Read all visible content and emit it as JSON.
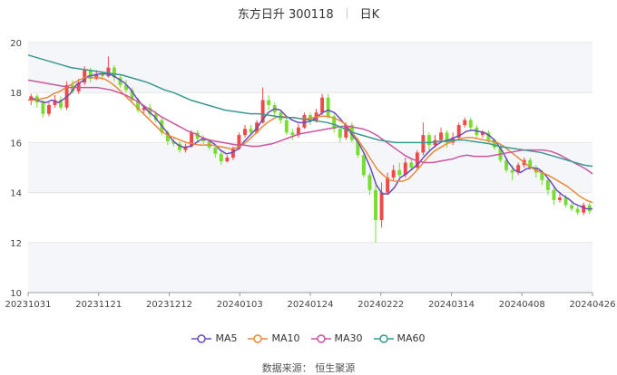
{
  "title": {
    "name": "东方日升",
    "code": "300118",
    "period": "日K"
  },
  "source": "数据来源： 恒生聚源",
  "chart_data": {
    "type": "candlestick",
    "ylim": [
      10,
      20
    ],
    "yticks": [
      "10",
      "12",
      "14",
      "16",
      "18",
      "20"
    ],
    "xticks": [
      "20231031",
      "20231121",
      "20231212",
      "20240103",
      "20240124",
      "20240222",
      "20240314",
      "20240408",
      "20240426"
    ],
    "grid": true,
    "legend_position": "bottom",
    "colors": {
      "up": "#ee4a4a",
      "down": "#77dd33",
      "ma5": "#6a4bbd",
      "ma10": "#e8893b",
      "ma30": "#cc55a0",
      "ma60": "#3a9990"
    },
    "series": [
      {
        "name": "MA5",
        "key": "ma5"
      },
      {
        "name": "MA10",
        "key": "ma10"
      },
      {
        "name": "MA30",
        "key": "ma30"
      },
      {
        "name": "MA60",
        "key": "ma60"
      }
    ],
    "candles": [
      [
        17.7,
        17.85,
        17.95,
        17.5
      ],
      [
        17.85,
        17.6,
        17.95,
        17.4
      ],
      [
        17.6,
        17.15,
        17.7,
        17.0
      ],
      [
        17.15,
        17.5,
        17.6,
        17.05
      ],
      [
        17.5,
        17.7,
        17.9,
        17.4
      ],
      [
        17.7,
        17.4,
        17.85,
        17.3
      ],
      [
        17.4,
        18.3,
        18.45,
        17.3
      ],
      [
        18.3,
        18.05,
        18.5,
        17.95
      ],
      [
        18.05,
        18.4,
        18.55,
        17.95
      ],
      [
        18.4,
        18.9,
        19.05,
        18.3
      ],
      [
        18.9,
        18.55,
        19.0,
        18.4
      ],
      [
        18.55,
        18.75,
        18.9,
        18.5
      ],
      [
        18.75,
        18.65,
        18.85,
        18.5
      ],
      [
        18.65,
        19.0,
        19.45,
        18.6
      ],
      [
        19.0,
        18.6,
        19.1,
        18.45
      ],
      [
        18.6,
        18.3,
        18.75,
        18.2
      ],
      [
        18.3,
        18.1,
        18.5,
        18.0
      ],
      [
        18.1,
        17.7,
        18.2,
        17.6
      ],
      [
        17.7,
        17.3,
        17.8,
        17.2
      ],
      [
        17.3,
        17.4,
        17.5,
        17.15
      ],
      [
        17.4,
        17.15,
        17.55,
        17.0
      ],
      [
        17.15,
        16.9,
        17.25,
        16.8
      ],
      [
        16.9,
        16.4,
        17.0,
        16.3
      ],
      [
        16.4,
        16.05,
        16.5,
        15.9
      ],
      [
        16.05,
        15.95,
        16.2,
        15.85
      ],
      [
        15.95,
        15.7,
        16.05,
        15.6
      ],
      [
        15.7,
        15.85,
        15.95,
        15.6
      ],
      [
        15.85,
        16.4,
        16.5,
        15.8
      ],
      [
        16.4,
        16.15,
        16.5,
        16.0
      ],
      [
        16.15,
        16.05,
        16.3,
        15.95
      ],
      [
        16.05,
        15.8,
        16.15,
        15.7
      ],
      [
        15.8,
        15.55,
        15.9,
        15.4
      ],
      [
        15.55,
        15.25,
        15.65,
        15.1
      ],
      [
        15.25,
        15.4,
        15.5,
        15.2
      ],
      [
        15.4,
        15.75,
        15.85,
        15.3
      ],
      [
        15.75,
        16.3,
        16.4,
        15.7
      ],
      [
        16.3,
        16.55,
        16.7,
        16.2
      ],
      [
        16.55,
        16.4,
        16.7,
        16.3
      ],
      [
        16.4,
        16.8,
        16.9,
        16.35
      ],
      [
        16.8,
        17.7,
        18.2,
        16.75
      ],
      [
        17.7,
        17.5,
        17.9,
        17.3
      ],
      [
        17.5,
        17.2,
        17.6,
        17.05
      ],
      [
        17.2,
        16.9,
        17.3,
        16.75
      ],
      [
        16.9,
        16.4,
        17.0,
        16.3
      ],
      [
        16.4,
        16.3,
        16.55,
        16.1
      ],
      [
        16.3,
        16.6,
        16.75,
        16.2
      ],
      [
        16.6,
        17.1,
        17.2,
        16.55
      ],
      [
        17.1,
        16.85,
        17.2,
        16.7
      ],
      [
        16.85,
        17.2,
        17.35,
        16.8
      ],
      [
        17.2,
        17.8,
        17.95,
        17.1
      ],
      [
        17.8,
        17.05,
        17.95,
        16.95
      ],
      [
        17.05,
        16.55,
        17.15,
        16.4
      ],
      [
        16.55,
        16.2,
        16.65,
        16.0
      ],
      [
        16.2,
        16.7,
        16.8,
        16.1
      ],
      [
        16.7,
        16.1,
        16.8,
        16.0
      ],
      [
        16.1,
        15.5,
        16.2,
        15.4
      ],
      [
        15.5,
        14.7,
        15.6,
        14.6
      ],
      [
        14.7,
        14.1,
        14.8,
        13.9
      ],
      [
        14.1,
        12.9,
        14.3,
        12.0
      ],
      [
        12.9,
        14.0,
        14.4,
        12.6
      ],
      [
        14.0,
        14.6,
        14.8,
        13.9
      ],
      [
        14.6,
        14.9,
        15.1,
        14.5
      ],
      [
        14.9,
        14.7,
        15.2,
        14.6
      ],
      [
        14.7,
        15.2,
        15.4,
        14.6
      ],
      [
        15.2,
        15.0,
        15.4,
        14.9
      ],
      [
        15.0,
        15.6,
        15.7,
        14.9
      ],
      [
        15.6,
        16.3,
        16.8,
        15.5
      ],
      [
        16.3,
        15.9,
        16.4,
        15.7
      ],
      [
        15.9,
        16.1,
        16.3,
        15.8
      ],
      [
        16.1,
        16.4,
        16.6,
        16.0
      ],
      [
        16.4,
        16.0,
        16.5,
        15.8
      ],
      [
        16.0,
        16.2,
        16.4,
        15.9
      ],
      [
        16.2,
        16.7,
        16.8,
        16.1
      ],
      [
        16.7,
        16.9,
        17.0,
        16.6
      ],
      [
        16.9,
        16.6,
        17.0,
        16.5
      ],
      [
        16.6,
        16.3,
        16.7,
        16.2
      ],
      [
        16.3,
        16.4,
        16.5,
        16.2
      ],
      [
        16.4,
        16.1,
        16.5,
        16.0
      ],
      [
        16.1,
        15.8,
        16.2,
        15.7
      ],
      [
        15.8,
        15.3,
        15.9,
        15.2
      ],
      [
        15.3,
        14.9,
        15.4,
        14.8
      ],
      [
        14.9,
        14.8,
        15.1,
        14.5
      ],
      [
        14.8,
        15.1,
        15.2,
        14.7
      ],
      [
        15.1,
        15.3,
        15.4,
        15.0
      ],
      [
        15.3,
        15.0,
        15.4,
        14.9
      ],
      [
        15.0,
        14.8,
        15.1,
        14.6
      ],
      [
        14.8,
        14.5,
        14.9,
        14.3
      ],
      [
        14.5,
        14.1,
        14.6,
        13.9
      ],
      [
        14.1,
        13.7,
        14.2,
        13.5
      ],
      [
        13.7,
        13.8,
        14.0,
        13.6
      ],
      [
        13.8,
        13.5,
        13.9,
        13.4
      ],
      [
        13.5,
        13.35,
        13.6,
        13.25
      ],
      [
        13.35,
        13.2,
        13.45,
        13.1
      ],
      [
        13.2,
        13.5,
        13.6,
        13.1
      ],
      [
        13.5,
        13.25,
        13.6,
        13.15
      ]
    ],
    "ma5": [
      17.7,
      17.75,
      17.65,
      17.6,
      17.7,
      17.6,
      17.75,
      17.95,
      18.3,
      18.45,
      18.65,
      18.7,
      18.75,
      18.75,
      18.7,
      18.55,
      18.4,
      18.15,
      17.8,
      17.5,
      17.25,
      17.05,
      16.75,
      16.45,
      16.1,
      15.9,
      15.8,
      15.85,
      16.0,
      16.15,
      16.1,
      15.95,
      15.7,
      15.55,
      15.6,
      15.75,
      16.05,
      16.3,
      16.55,
      16.9,
      17.2,
      17.35,
      17.3,
      17.05,
      16.9,
      16.8,
      16.8,
      16.85,
      17.0,
      17.2,
      17.3,
      17.2,
      16.95,
      16.65,
      16.3,
      16.0,
      15.55,
      15.0,
      14.3,
      13.95,
      13.95,
      14.2,
      14.6,
      14.75,
      14.95,
      15.15,
      15.45,
      15.7,
      15.9,
      16.05,
      16.1,
      16.2,
      16.3,
      16.45,
      16.5,
      16.45,
      16.4,
      16.25,
      16.0,
      15.65,
      15.2,
      14.9,
      14.8,
      14.95,
      15.0,
      14.95,
      14.75,
      14.45,
      14.1,
      13.9,
      13.75,
      13.55,
      13.45,
      13.35,
      13.35
    ],
    "ma10": [
      17.7,
      17.7,
      17.75,
      17.8,
      17.95,
      18.05,
      18.2,
      18.35,
      18.5,
      18.6,
      18.6,
      18.6,
      18.55,
      18.4,
      18.2,
      17.95,
      17.7,
      17.45,
      17.2,
      16.95,
      16.7,
      16.45,
      16.3,
      16.2,
      16.1,
      16.0,
      15.95,
      15.9,
      15.9,
      15.9,
      15.85,
      15.8,
      15.75,
      15.8,
      15.95,
      16.15,
      16.4,
      16.65,
      16.85,
      17.0,
      17.05,
      17.0,
      17.0,
      16.95,
      16.95,
      17.0,
      17.05,
      17.05,
      17.0,
      16.9,
      16.75,
      16.45,
      16.1,
      15.75,
      15.35,
      14.95,
      14.7,
      14.5,
      14.45,
      14.45,
      14.55,
      14.8,
      15.1,
      15.4,
      15.65,
      15.8,
      15.95,
      16.05,
      16.15,
      16.2,
      16.2,
      16.15,
      16.1,
      16.05,
      16.0,
      15.85,
      15.65,
      15.45,
      15.25,
      15.05,
      14.9,
      14.8,
      14.7,
      14.55,
      14.4,
      14.25,
      14.05,
      13.85,
      13.7,
      13.6
    ],
    "ma30": [
      18.5,
      18.45,
      18.4,
      18.35,
      18.3,
      18.25,
      18.2,
      18.2,
      18.2,
      18.2,
      18.2,
      18.15,
      18.1,
      18.0,
      17.9,
      17.75,
      17.6,
      17.4,
      17.25,
      17.05,
      16.9,
      16.75,
      16.6,
      16.45,
      16.35,
      16.2,
      16.1,
      16.05,
      16.0,
      15.95,
      15.9,
      15.9,
      15.85,
      15.85,
      15.9,
      15.95,
      16.05,
      16.15,
      16.25,
      16.35,
      16.4,
      16.45,
      16.5,
      16.55,
      16.6,
      16.65,
      16.65,
      16.6,
      16.55,
      16.45,
      16.3,
      16.1,
      15.9,
      15.7,
      15.5,
      15.35,
      15.25,
      15.2,
      15.2,
      15.25,
      15.3,
      15.35,
      15.45,
      15.5,
      15.45,
      15.45,
      15.45,
      15.5,
      15.55,
      15.6,
      15.65,
      15.7,
      15.7,
      15.7,
      15.7,
      15.65,
      15.55,
      15.4,
      15.25,
      15.1,
      14.95,
      14.75
    ],
    "ma60": [
      19.5,
      19.4,
      19.3,
      19.2,
      19.1,
      19.0,
      18.95,
      18.9,
      18.85,
      18.8,
      18.75,
      18.7,
      18.6,
      18.5,
      18.4,
      18.25,
      18.1,
      18.0,
      17.85,
      17.7,
      17.6,
      17.5,
      17.4,
      17.3,
      17.25,
      17.2,
      17.15,
      17.15,
      17.1,
      17.05,
      17.0,
      17.0,
      16.95,
      16.9,
      16.85,
      16.8,
      16.7,
      16.55,
      16.4,
      16.3,
      16.2,
      16.1,
      16.05,
      16.0,
      16.0,
      16.0,
      16.0,
      16.0,
      16.05,
      16.05,
      16.1,
      16.1,
      16.05,
      16.0,
      15.95,
      15.85,
      15.8,
      15.75,
      15.7,
      15.65,
      15.6,
      15.5,
      15.4,
      15.3,
      15.2,
      15.1,
      15.05
    ]
  }
}
